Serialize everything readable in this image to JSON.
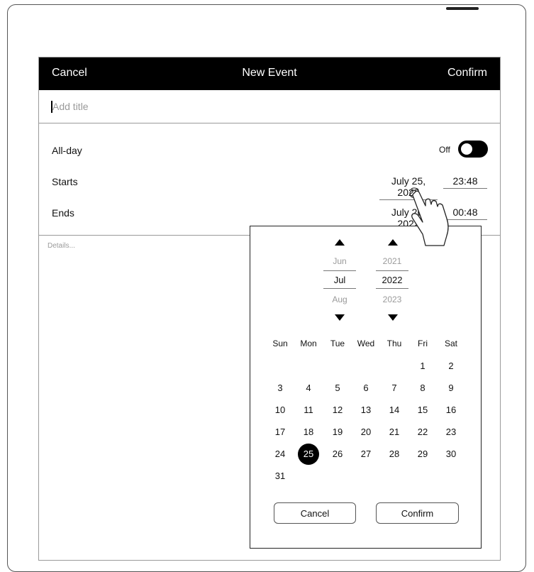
{
  "header": {
    "cancel": "Cancel",
    "title": "New Event",
    "confirm": "Confirm"
  },
  "title_field": {
    "placeholder": "Add title",
    "value": ""
  },
  "allday": {
    "label": "All-day",
    "state": "Off"
  },
  "starts": {
    "label": "Starts",
    "date": "July 25, 2022",
    "time": "23:48"
  },
  "ends": {
    "label": "Ends",
    "date": "July 26, 2022",
    "time": "00:48"
  },
  "details": {
    "placeholder": "Details..."
  },
  "picker": {
    "months": {
      "prev": "Jun",
      "current": "Jul",
      "next": "Aug"
    },
    "years": {
      "prev": "2021",
      "current": "2022",
      "next": "2023"
    },
    "weekdays": [
      "Sun",
      "Mon",
      "Tue",
      "Wed",
      "Thu",
      "Fri",
      "Sat"
    ],
    "weeks": [
      [
        "",
        "",
        "",
        "",
        "",
        "1",
        "2"
      ],
      [
        "3",
        "4",
        "5",
        "6",
        "7",
        "8",
        "9"
      ],
      [
        "10",
        "11",
        "12",
        "13",
        "14",
        "15",
        "16"
      ],
      [
        "17",
        "18",
        "19",
        "20",
        "21",
        "22",
        "23"
      ],
      [
        "24",
        "25",
        "26",
        "27",
        "28",
        "29",
        "30"
      ],
      [
        "31",
        "",
        "",
        "",
        "",
        "",
        ""
      ]
    ],
    "selected_day": "25",
    "cancel": "Cancel",
    "confirm": "Confirm"
  },
  "icons": {
    "month_up": "triangle-up-icon",
    "month_down": "triangle-down-icon",
    "year_up": "triangle-up-icon",
    "year_down": "triangle-down-icon",
    "hand": "tapping-hand-icon"
  },
  "colors": {
    "bar": "#000000",
    "accent": "#000000",
    "muted": "#9a9a9a"
  }
}
